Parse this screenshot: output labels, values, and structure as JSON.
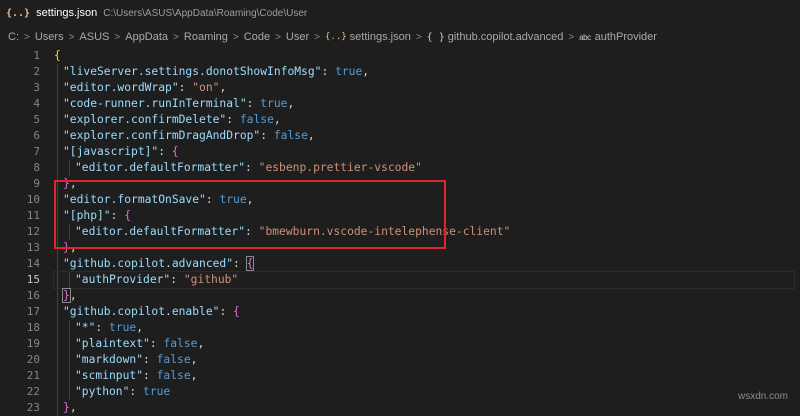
{
  "tab": {
    "icon": "json-braces-icon",
    "glyph": "{..}",
    "title": "settings.json",
    "path": "C:\\Users\\ASUS\\AppData\\Roaming\\Code\\User"
  },
  "breadcrumb": {
    "items": [
      "C:",
      "Users",
      "ASUS",
      "AppData",
      "Roaming",
      "Code",
      "User"
    ],
    "file": "settings.json",
    "file_glyph": "{..}",
    "object_glyph": "{ }",
    "object": "github.copilot.advanced",
    "string_glyph": "abc",
    "leaf": "authProvider",
    "separator": ">"
  },
  "editor": {
    "line_numbers": [
      "1",
      "2",
      "3",
      "4",
      "5",
      "6",
      "7",
      "8",
      "9",
      "10",
      "11",
      "12",
      "13",
      "14",
      "15",
      "16",
      "17",
      "18",
      "19",
      "20",
      "21",
      "22",
      "23"
    ],
    "active_line": "15",
    "lines": {
      "l1_open": "{",
      "l2_key": "\"liveServer.settings.donotShowInfoMsg\"",
      "l2_val": "true",
      "l3_key": "\"editor.wordWrap\"",
      "l3_val": "\"on\"",
      "l4_key": "\"code-runner.runInTerminal\"",
      "l4_val": "true",
      "l5_key": "\"explorer.confirmDelete\"",
      "l5_val": "false",
      "l6_key": "\"explorer.confirmDragAndDrop\"",
      "l6_val": "false",
      "l7_key": "\"[javascript]\"",
      "l7_open": "{",
      "l8_key": "\"editor.defaultFormatter\"",
      "l8_val": "\"esbenp.prettier-vscode\"",
      "l9_close": "}",
      "l10_key": "\"editor.formatOnSave\"",
      "l10_val": "true",
      "l11_key": "\"[php]\"",
      "l11_open": "{",
      "l12_key": "\"editor.defaultFormatter\"",
      "l12_val": "\"bmewburn.vscode-intelephense-client\"",
      "l13_close": "}",
      "l14_key": "\"github.copilot.advanced\"",
      "l14_open": "{",
      "l15_key": "\"authProvider\"",
      "l15_val": "\"github\"",
      "l16_close": "}",
      "l17_key": "\"github.copilot.enable\"",
      "l17_open": "{",
      "l18_key": "\"*\"",
      "l18_val": "true",
      "l19_key": "\"plaintext\"",
      "l19_val": "false",
      "l20_key": "\"markdown\"",
      "l20_val": "false",
      "l21_key": "\"scminput\"",
      "l21_val": "false",
      "l22_key": "\"python\"",
      "l22_val": "true",
      "l23_close": "}"
    }
  },
  "annotation": {
    "color": "#e0242b"
  },
  "watermark": "wsxdn.com",
  "colors": {
    "background": "#1e1e1e",
    "key": "#9cdcfe",
    "string": "#ce9178",
    "boolean": "#569cd6",
    "bracket_level1": "#ffd700",
    "bracket_level2": "#da70d6"
  }
}
